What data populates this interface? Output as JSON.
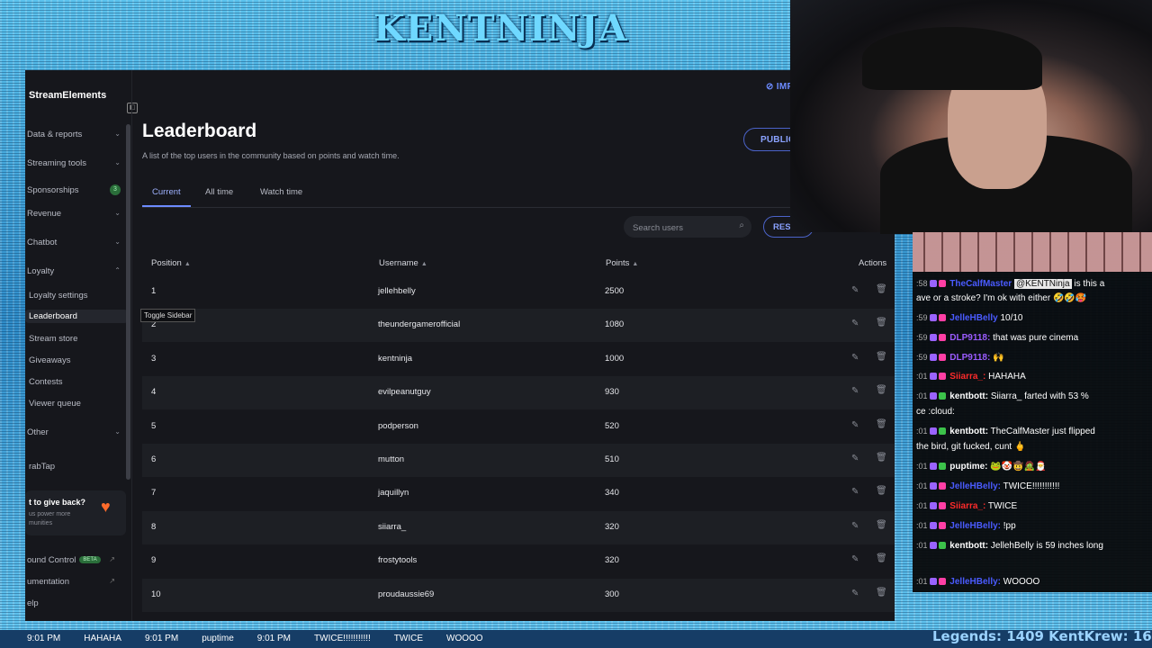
{
  "overlay": {
    "title": "KENTNINJA",
    "legends": "Legends: 1409 KentKrew: 16"
  },
  "sidebar": {
    "brand": "StreamElements",
    "items": [
      {
        "label": "Data & reports",
        "chev": "⌄"
      },
      {
        "label": "Streaming tools",
        "chev": "⌄"
      },
      {
        "label": "Sponsorships",
        "badge": "3"
      },
      {
        "label": "Revenue",
        "chev": "⌄"
      },
      {
        "label": "Chatbot",
        "chev": "⌄"
      },
      {
        "label": "Loyalty",
        "chev": "⌃"
      },
      {
        "label": "Loyalty settings"
      },
      {
        "label": "Leaderboard"
      },
      {
        "label": "Stream store"
      },
      {
        "label": "Giveaways"
      },
      {
        "label": "Contests"
      },
      {
        "label": "Viewer queue"
      },
      {
        "label": "Other",
        "chev": "⌄"
      },
      {
        "label": "rabTap"
      }
    ],
    "giveback_title": "t to give back?",
    "giveback_text": "us power more munities",
    "background_control": "ound Control",
    "beta": "BETA",
    "documentation": "umentation",
    "help": "elp"
  },
  "header": {
    "import": "IMPORT"
  },
  "page": {
    "title": "Leaderboard",
    "subtitle": "A list of the top users in the community based on points and watch time.",
    "public_button": "PUBLIC LEADERBOARD",
    "tabs": [
      "Current",
      "All time",
      "Watch time"
    ],
    "search_placeholder": "Search users",
    "reset": "RESE",
    "tooltip": "Toggle Sidebar"
  },
  "table": {
    "headers": {
      "position": "Position",
      "username": "Username",
      "points": "Points",
      "actions": "Actions"
    },
    "rows": [
      {
        "position": "1",
        "username": "jellehbelly",
        "points": "2500"
      },
      {
        "position": "2",
        "username": "theundergamerofficial",
        "points": "1080"
      },
      {
        "position": "3",
        "username": "kentninja",
        "points": "1000"
      },
      {
        "position": "4",
        "username": "evilpeanutguy",
        "points": "930"
      },
      {
        "position": "5",
        "username": "podperson",
        "points": "520"
      },
      {
        "position": "6",
        "username": "mutton",
        "points": "510"
      },
      {
        "position": "7",
        "username": "jaquillyn",
        "points": "340"
      },
      {
        "position": "8",
        "username": "siiarra_",
        "points": "320"
      },
      {
        "position": "9",
        "username": "frostytools",
        "points": "320"
      },
      {
        "position": "10",
        "username": "proudaussie69",
        "points": "300"
      }
    ]
  },
  "chat": {
    "messages": [
      {
        "ts": ":58",
        "name": "TheCalfMaster",
        "name_class": "blue",
        "mention": "@KENTNinja",
        "text": " is this a"
      },
      {
        "ts": "",
        "name": "",
        "text": "ave or a stroke? I'm ok with either 🤣🤣🥵"
      },
      {
        "ts": ":59",
        "name": "JelleHBelly",
        "name_class": "blue",
        "text": " 10/10"
      },
      {
        "ts": ":59",
        "name": "DLP9118:",
        "name_class": "purple",
        "text": " that was pure cinema"
      },
      {
        "ts": ":59",
        "name": "DLP9118:",
        "name_class": "purple",
        "text": " 🙌"
      },
      {
        "ts": ":01",
        "name": "Siiarra_:",
        "name_class": "red",
        "text": " HAHAHA"
      },
      {
        "ts": ":01",
        "name": "kentbott:",
        "name_class": "white",
        "text": " Siiarra_ farted with 53 %"
      },
      {
        "ts": "",
        "name": "",
        "text": "ce :cloud:"
      },
      {
        "ts": ":01",
        "name": "kentbott:",
        "name_class": "white",
        "text": " TheCalfMaster just flipped"
      },
      {
        "ts": "",
        "name": "",
        "text": "the bird, git fucked, cunt 🖕"
      },
      {
        "ts": ":01",
        "name": "puptime:",
        "name_class": "white",
        "text": " 🐸🤡🤠🧟🎅"
      },
      {
        "ts": ":01",
        "name": "JelleHBelly:",
        "name_class": "blue",
        "text": " TWICE!!!!!!!!!!!"
      },
      {
        "ts": ":01",
        "name": "Siiarra_:",
        "name_class": "red",
        "text": " TWICE"
      },
      {
        "ts": ":01",
        "name": "JelleHBelly:",
        "name_class": "blue",
        "text": " !pp"
      },
      {
        "ts": ":01",
        "name": "kentbott:",
        "name_class": "white",
        "text": " JellehBelly is 59 inches long"
      },
      {
        "ts": ":01",
        "name": "JelleHBelly:",
        "name_class": "blue",
        "text": " WOOOO"
      }
    ]
  },
  "ticker": [
    "9:01 PM",
    "HAHAHA",
    "9:01 PM",
    "puptime",
    "9:01 PM",
    "TWICE!!!!!!!!!!!",
    "TWICE",
    "WOOOO"
  ],
  "colors": {
    "accent": "#6c8bff",
    "panel": "#16171c",
    "orange_heart": "#ff6b2b"
  }
}
